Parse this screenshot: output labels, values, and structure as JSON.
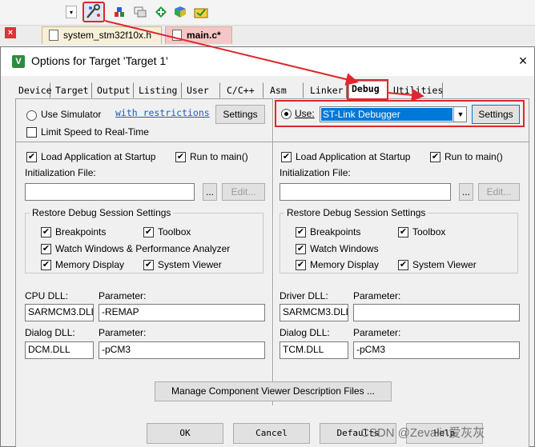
{
  "editor_tabs": [
    {
      "label": "system_stm32f10x.h"
    },
    {
      "label": "main.c*"
    }
  ],
  "toolbar": {
    "icons": [
      "dropdown-icon",
      "debug-settings-icon",
      "download-icon",
      "translate-icon",
      "manage-icon",
      "pack-installer-icon",
      "select-software-packs-icon"
    ]
  },
  "dialog": {
    "title": "Options for Target 'Target 1'",
    "close_glyph": "×",
    "tabs": [
      "Device",
      "Target",
      "Output",
      "Listing",
      "User",
      "C/C++",
      "Asm",
      "Linker",
      "Debug",
      "Utilities"
    ],
    "active_tab": "Debug"
  },
  "left": {
    "use_simulator": "Use Simulator",
    "with_restrictions": "with restrictions",
    "settings": "Settings",
    "limit_speed": "Limit Speed to Real-Time",
    "load_app": "Load Application at Startup",
    "run_to_main": "Run to main()",
    "init_file_label": "Initialization File:",
    "init_file_value": "",
    "browse": "...",
    "edit": "Edit...",
    "restore_title": "Restore Debug Session Settings",
    "breakpoints": "Breakpoints",
    "toolbox": "Toolbox",
    "watch_windows": "Watch Windows & Performance Analyzer",
    "memory_display": "Memory Display",
    "system_viewer": "System Viewer",
    "cpu_dll_label": "CPU DLL:",
    "cpu_param_label": "Parameter:",
    "cpu_dll": "SARMCM3.DLL",
    "cpu_param": "-REMAP",
    "dialog_dll_label": "Dialog DLL:",
    "dialog_param_label": "Parameter:",
    "dialog_dll": "DCM.DLL",
    "dialog_param": "-pCM3"
  },
  "right": {
    "use": "Use:",
    "debugger": "ST-Link Debugger",
    "settings": "Settings",
    "load_app": "Load Application at Startup",
    "run_to_main": "Run to main()",
    "init_file_label": "Initialization File:",
    "init_file_value": "",
    "browse": "...",
    "edit": "Edit...",
    "restore_title": "Restore Debug Session Settings",
    "breakpoints": "Breakpoints",
    "toolbox": "Toolbox",
    "watch_windows": "Watch Windows",
    "memory_display": "Memory Display",
    "system_viewer": "System Viewer",
    "driver_dll_label": "Driver DLL:",
    "driver_param_label": "Parameter:",
    "driver_dll": "SARMCM3.DLL",
    "driver_param": "",
    "dialog_dll_label": "Dialog DLL:",
    "dialog_param_label": "Parameter:",
    "dialog_dll": "TCM.DLL",
    "dialog_param": "-pCM3"
  },
  "manage_button": "Manage Component Viewer Description Files ...",
  "footer": {
    "ok": "OK",
    "cancel": "Cancel",
    "defaults": "Defaults",
    "help": "Help"
  },
  "watermark": "CSDN @Zevalin爱灰灰",
  "check_glyph": "✔",
  "colors": {
    "annotation": "#e0262b",
    "selection": "#0078d7",
    "link": "#1a5fb4"
  }
}
